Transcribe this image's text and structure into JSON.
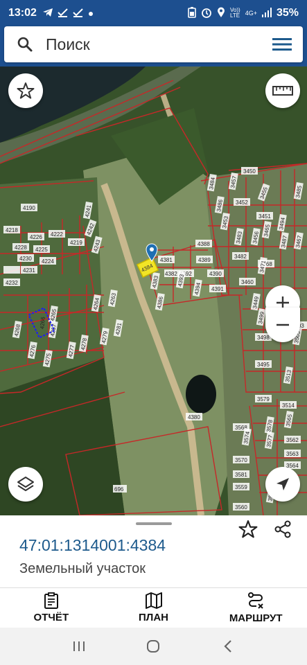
{
  "status_bar": {
    "time": "13:02",
    "left_icons": [
      "telegram-icon",
      "check-icon",
      "check-icon",
      "dot-icon"
    ],
    "right_icons": [
      "battery-saver-icon",
      "alarm-icon",
      "location-icon",
      "volte-icon",
      "4g-icon",
      "signal-icon"
    ],
    "volte_text": "Vo))\nLTE",
    "net_text": "4G+",
    "battery": "35%"
  },
  "search": {
    "placeholder": "Поиск"
  },
  "map": {
    "parcel_labels": [
      "4190",
      "4241",
      "4218",
      "4226",
      "4222",
      "4242",
      "4228",
      "4225",
      "4219",
      "4243",
      "4230",
      "4224",
      "4232",
      "4231",
      "4381",
      "4388",
      "4392",
      "4382",
      "4393",
      "4389",
      "4390",
      "4383",
      "4394",
      "4391",
      "4386",
      "4380",
      "3484",
      "3457",
      "3450",
      "3452",
      "3455",
      "3485",
      "3453",
      "3486",
      "3451",
      "3456",
      "3483",
      "3494",
      "3487",
      "3465",
      "3482",
      "3467",
      "3471",
      "3468",
      "3460",
      "3449",
      "3498",
      "3503",
      "3499",
      "3505",
      "3495",
      "3513",
      "3579",
      "3514",
      "3562",
      "3563",
      "3564",
      "3570",
      "3581",
      "3559",
      "3560",
      "3568",
      "3577",
      "3578",
      "3565",
      "3574",
      "3573",
      "696",
      "4264",
      "4263",
      "4265",
      "4266",
      "4267",
      "4268",
      "4275",
      "4277",
      "4278",
      "4281",
      "4279",
      "4276"
    ],
    "marker_parcel": "4384"
  },
  "sheet": {
    "cadastral_number": "47:01:1314001:4384",
    "parcel_type": "Земельный участок"
  },
  "actions": [
    {
      "label": "ОТЧЁТ",
      "icon": "report-clipboard-icon"
    },
    {
      "label": "ПЛАН",
      "icon": "map-plan-icon"
    },
    {
      "label": "МАРШРУТ",
      "icon": "route-icon"
    }
  ],
  "colors": {
    "primary": "#1d4f8f",
    "link": "#1d5a8c",
    "parcel_outline": "#c62828"
  }
}
